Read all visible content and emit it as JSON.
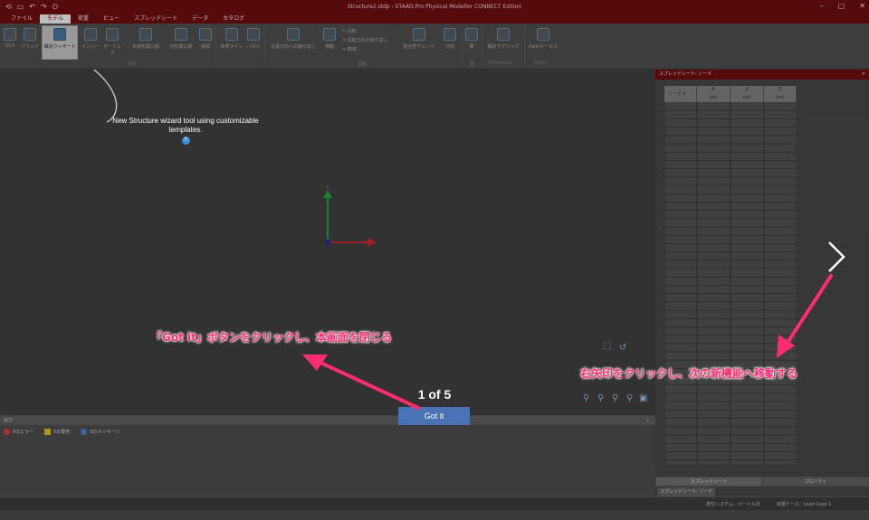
{
  "window": {
    "title": "Structure2.stdp - STAAD.Pro Physical Modeller CONNECT Edition"
  },
  "menu": {
    "items": [
      "ファイル",
      "モデル",
      "荷重",
      "ビュー",
      "スプレッドシート",
      "データ",
      "カタログ"
    ],
    "active_index": 1
  },
  "ribbon": {
    "buttons": {
      "ucs": "UCS",
      "grid": "グリッド",
      "wizard": "構造ウィザード",
      "member": "メンバー",
      "surface": "サーフェス",
      "poly_opening": "多角形開口部",
      "circ_opening": "円形開口部",
      "region": "領域",
      "ref_line": "参照ライン",
      "panel": "パネル",
      "repeat_dir": "合進方向への繰り返し",
      "move": "移動",
      "rotate": "回転",
      "rotate_repeat": "回転方向の繰り返し",
      "mirror": "鏡映",
      "consistency": "整合性チェック",
      "split": "分割",
      "layer": "層",
      "analysis": "解析モデリング",
      "itwin": "iTwinサービス"
    },
    "groups": {
      "create": "作成",
      "edit": "編集",
      "layer": "層",
      "staad": "STAAD.Pro",
      "itwin": "iTwin"
    }
  },
  "tooltip": {
    "text": "New Structure wizard tool using customizable templates.",
    "help_icon": "?"
  },
  "axes": {
    "x": "X",
    "y": "Y"
  },
  "output": {
    "title": "出力",
    "tabs": [
      "0のエラー",
      "0の警告",
      "0のメッセージ"
    ]
  },
  "spreadsheet": {
    "title": "スプレッドシート: ノード",
    "columns": [
      {
        "name": "ノード",
        "unit": ""
      },
      {
        "name": "X",
        "unit": "(m)"
      },
      {
        "name": "Y",
        "unit": "(m)"
      },
      {
        "name": "Z",
        "unit": "(m)"
      }
    ],
    "bottom_tabs": [
      "スプレッドシート",
      "プロパティ"
    ],
    "doc_tab": "スプレッドシート: ノード"
  },
  "statusbar": {
    "unit_system": "単位システム：メートル法",
    "load_case": "荷重ケース：Load Case 1"
  },
  "walkthrough": {
    "pager": "1 of 5",
    "got_it_label": "Got it",
    "next_icon": "chevron-right-icon"
  },
  "annotations": {
    "close_hint": "「Got it」ボタンをクリックし、本画面を閉じる",
    "next_hint": "右矢印をクリックし、次の新機能へ移動する"
  },
  "colors": {
    "title_bar": "#6b0d0d",
    "annotation": "#ff2d6e",
    "button": "#4a73b5",
    "x_axis": "#c0282a",
    "y_axis": "#22a03a"
  }
}
